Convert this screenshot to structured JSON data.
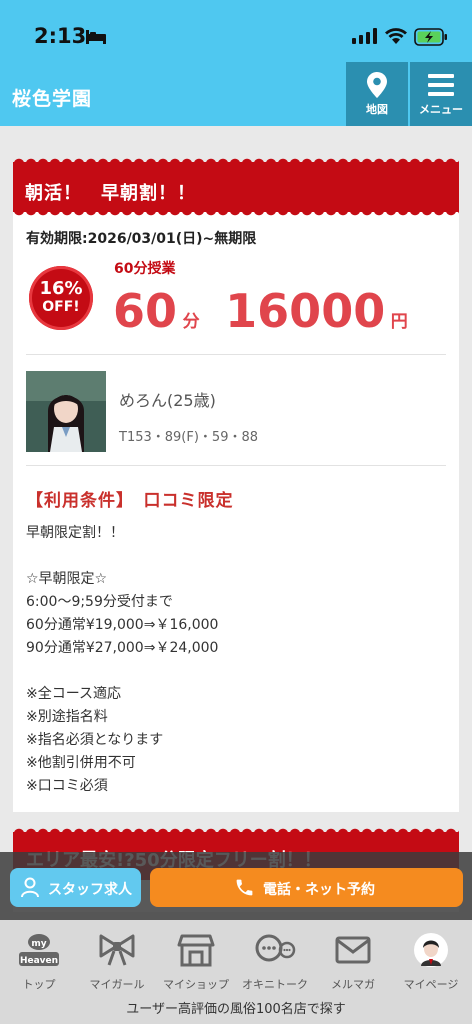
{
  "status_bar": {
    "time": "2:13"
  },
  "header": {
    "title": "桜色学園",
    "map_label": "地図",
    "menu_label": "メニュー"
  },
  "coupon": {
    "banner_title": "朝活！　早朝割！！",
    "validity": "有効期限:2026/03/01(日)~無期限",
    "discount_pct": "16%",
    "discount_off": "OFF!",
    "course_name": "60分授業",
    "minutes": "60",
    "minutes_unit": "分",
    "price": "16000",
    "price_unit": "円",
    "girl_name": "めろん(25歳)",
    "girl_size": "T153・89(F)・59・88",
    "conditions_title": "【利用条件】　口コミ限定",
    "details": [
      "早朝限定割！！",
      "",
      "☆早朝限定☆",
      "6:00～9;59分受付まで",
      "60分通常¥19,000⇒￥16,000",
      "90分通常¥27,000⇒￥24,000",
      "",
      "※全コース適応",
      "※別途指名料",
      "※指名必須となります",
      "※他割引併用不可",
      "※口コミ必須"
    ]
  },
  "coupon2": {
    "banner_title": "エリア最安!?50分限定フリー割！！"
  },
  "actions": {
    "staff_label": "スタッフ求人",
    "call_label": "電話・ネット予約"
  },
  "tabs": [
    {
      "label": "トップ",
      "icon": "myheaven-icon"
    },
    {
      "label": "マイガール",
      "icon": "ribbon-icon"
    },
    {
      "label": "マイショップ",
      "icon": "shop-icon"
    },
    {
      "label": "オキニトーク",
      "icon": "chat-icon"
    },
    {
      "label": "メルマガ",
      "icon": "mail-icon"
    },
    {
      "label": "マイページ",
      "icon": "avatar-icon"
    }
  ],
  "myheaven_logo": {
    "top": "my",
    "bottom": "Heaven"
  },
  "footer_note": "ユーザー高評価の風俗100名店で探す",
  "colors": {
    "header": "#4fc8f0",
    "banner": "#c40b14",
    "price": "#e0454c",
    "call": "#f58b1f",
    "staff": "#62c9ef"
  }
}
